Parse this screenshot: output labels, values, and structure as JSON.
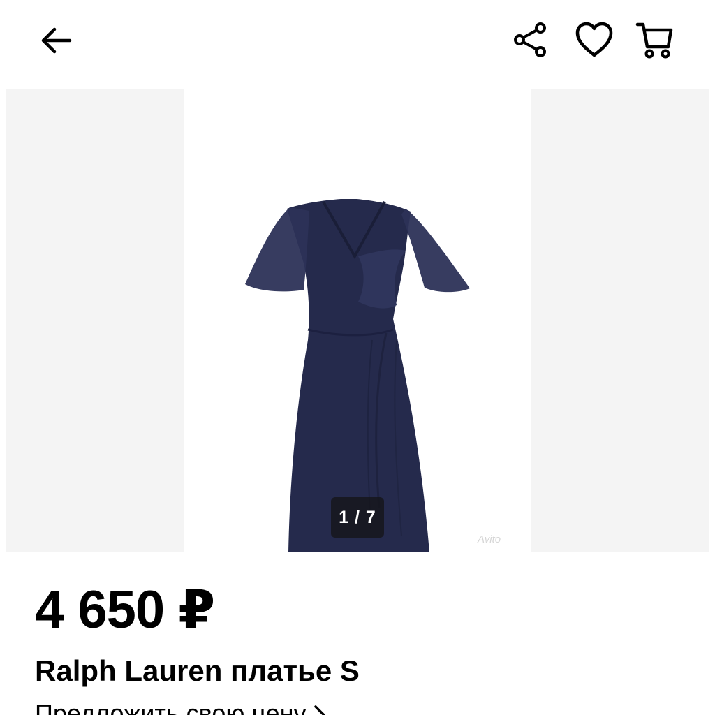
{
  "header": {
    "icons": [
      "arrow-left-icon",
      "share-icon",
      "heart-icon",
      "cart-icon"
    ]
  },
  "gallery": {
    "counter": "1 / 7",
    "watermark": "Avito",
    "colors": {
      "side_bg": "#f4f4f4",
      "dress": "#252a4c"
    }
  },
  "listing": {
    "price": "4 650 ₽",
    "title": "Ralph Lauren платье S",
    "offer_label": "Предложить свою цену"
  }
}
